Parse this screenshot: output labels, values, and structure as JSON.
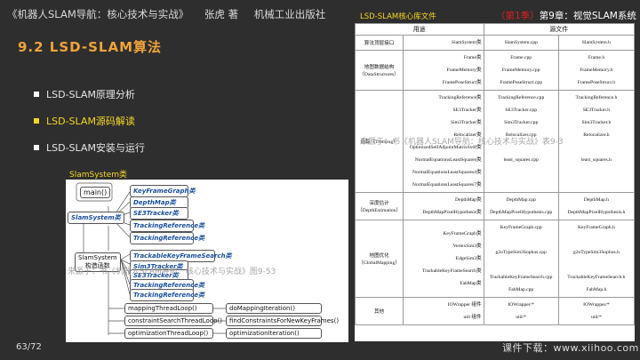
{
  "header": {
    "book_title": "《机器人SLAM导航：核心技术与实战》",
    "author": "张虎 著",
    "publisher": "机械工业出版社"
  },
  "section_title": "9.2 LSD-SLAM算法",
  "bullets": [
    {
      "label": "LSD-SLAM原理分析"
    },
    {
      "label": "LSD-SLAM源码解读"
    },
    {
      "label": "LSD-SLAM安装与运行"
    }
  ],
  "diagram": {
    "caption": "SlamSystem类",
    "main_label": "main()",
    "slam_system_label": "SlamSystem类",
    "slam_system_box": "SlamSystem",
    "slam_system_sub": "构造函数",
    "top_items": [
      "KeyFrameGraph类",
      "DepthMap类",
      "SE3Tracker类",
      "TrackingReference类",
      "TrackingReference类"
    ],
    "bottom_items": [
      "TrackableKeyFrameSearch类",
      "Sim3Tracker类",
      "SE3Tracker类",
      "TrackingReference类",
      "TrackingReference类"
    ],
    "threads": [
      "mappingThreadLoop()",
      "constraintSearchThreadLoop()",
      "optimizationThreadLoop()"
    ],
    "thread_targets": [
      "doMappingIteration()",
      "findConstraintsForNewKeyFrames()",
      "optimizationIteration()"
    ],
    "watermark": "来源于：书《机器人SLAM导航：核心技术与实战》图9-53"
  },
  "right": {
    "label": "LSD-SLAM核心库文件",
    "chapter_prefix": "（第1季）",
    "chapter": "第9章：视觉SLAM系统",
    "watermark": "来源于：书《机器人SLAM导航：核心技术与实战》表9-3",
    "col_use": "用途",
    "col_src": "源文件",
    "rows": [
      {
        "cat": "算法顶层接口",
        "items": [
          "SlamSystem类"
        ],
        "cpp": [
          "SlamSystem.cpp"
        ],
        "h": [
          "SlamSystem.h"
        ]
      },
      {
        "cat": "地图数据结构（DataStructures）",
        "items": [
          "Frame类",
          "FrameMemory类",
          "FramePoseStruct类"
        ],
        "cpp": [
          "Frame.cpp",
          "FrameMemory.cpp",
          "FramePoseStruct.cpp"
        ],
        "h": [
          "Frame.h",
          "FrameMemory.h",
          "FramePoseStruct.h"
        ]
      },
      {
        "cat": "追踪（Tracking）",
        "items": [
          "TrackingReference类",
          "SE3Tracker类",
          "Sim3Tracker类",
          "Relocalizer类",
          "OptimizedSelfAdjointMatrix6x6f类",
          "NormalEquationsLeastSquares类",
          "NormalEquationsLeastSquares4类",
          "NormalEquationsLeastSquares7类"
        ],
        "cpp": [
          "TrackingReference.cpp",
          "SE3Tracker.cpp",
          "Sim3Tracker.cpp",
          "Relocalizer.cpp",
          "",
          "least_squares.cpp",
          "",
          ""
        ],
        "h": [
          "TrackingReference.h",
          "SE3Tracker.h",
          "Sim3Tracker.h",
          "Relocalizer.h",
          "",
          "least_squares.h",
          "",
          ""
        ]
      },
      {
        "cat": "深度估计（DepthEstimation）",
        "items": [
          "DepthMap类",
          "DepthMapPixelHypothesis类"
        ],
        "cpp": [
          "DepthMap.cpp",
          "DepthMapPixelHypothesis.cpp"
        ],
        "h": [
          "DepthMap.h",
          "DepthMapPixelHypothesis.h"
        ]
      },
      {
        "cat": "地图优化（GlobalMapping）",
        "items": [
          "KeyFrameGraph类",
          "VertexSim3类",
          "EdgeSim3类",
          "TrackableKeyFrameSearch类",
          "FabMap类"
        ],
        "cpp": [
          "KeyFrameGraph.cpp",
          "",
          "g2oTypeSim3Sophus.cpp",
          "",
          "TrackableKeyFrameSearch.cpp",
          "FabMap.cpp"
        ],
        "h": [
          "KeyFrameGraph.h",
          "",
          "g2oTypeSim3Sophus.h",
          "",
          "TrackableKeyFrameSearch.h",
          "FabMap.h"
        ]
      },
      {
        "cat": "其他",
        "items": [
          "IOWrapper 组件",
          "util 组件"
        ],
        "cpp": [
          "IOWrapper/*",
          "util/*"
        ],
        "h": [
          "IOWrapper/*",
          "util/*"
        ]
      }
    ]
  },
  "page_number": "63/72",
  "footer": "课件下载：www.xiihoo.com",
  "colors": {
    "bg": "#2e2e2e",
    "title": "#f0a43a",
    "highlight": "#f5d623",
    "red": "#e02020",
    "blue_label": "#1a4fa0"
  }
}
